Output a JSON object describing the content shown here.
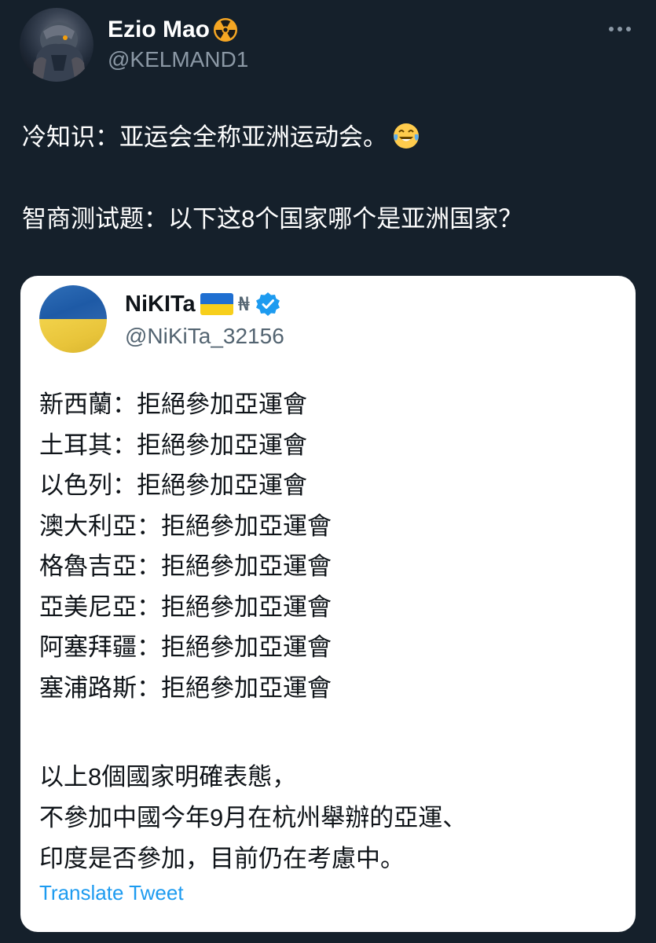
{
  "author": {
    "display_name": "Ezio Mao",
    "name_emoji_icon": "radioactive-icon",
    "handle": "@KELMAND1"
  },
  "tweet": {
    "line1": "冷知识：亚运会全称亚洲运动会。",
    "line1_emoji_icon": "tears-of-joy-icon",
    "line2": "智商测试题：以下这8个国家哪个是亚洲国家？"
  },
  "quoted": {
    "display_name": "NiKITa",
    "flag_icon": "ukraine-flag-icon",
    "symbol": "₦",
    "verified_icon": "verified-badge-icon",
    "handle": "@NiKiTa_32156",
    "rows": [
      {
        "country": "新西蘭：",
        "status": "拒絕參加亞運會"
      },
      {
        "country": "土耳其：",
        "status": "拒絕參加亞運會"
      },
      {
        "country": "以色列：",
        "status": "拒絕參加亞運會"
      },
      {
        "country": "澳大利亞：",
        "status": "拒絕參加亞運會"
      },
      {
        "country": "格魯吉亞：",
        "status": "拒絕參加亞運會"
      },
      {
        "country": "亞美尼亞：",
        "status": "拒絕參加亞運會"
      },
      {
        "country": "阿塞拜疆：",
        "status": "拒絕參加亞運會"
      },
      {
        "country": "塞浦路斯：",
        "status": "拒絕參加亞運會"
      }
    ],
    "paragraph": [
      "以上8個國家明確表態，",
      "不參加中國今年9月在杭州舉辦的亞運、",
      "印度是否參加，目前仍在考慮中。"
    ],
    "translate_label": "Translate Tweet"
  },
  "colors": {
    "background": "#15202b",
    "card": "#ffffff",
    "link": "#1d9bf0",
    "muted": "#8b98a5"
  }
}
